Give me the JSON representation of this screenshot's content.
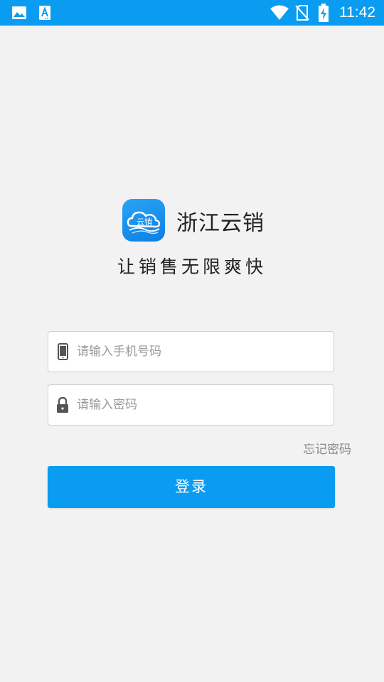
{
  "status_bar": {
    "time": "11:42",
    "background_color": "#0a9cf0",
    "left_icons": [
      "image-icon",
      "font-a-icon"
    ],
    "right_icons": [
      "wifi-icon",
      "no-sim-icon",
      "battery-charging-icon"
    ]
  },
  "app": {
    "icon_text": "云销",
    "name": "浙江云销",
    "slogan": "让销售无限爽快"
  },
  "form": {
    "phone": {
      "icon": "phone-icon",
      "placeholder": "请输入手机号码",
      "value": ""
    },
    "password": {
      "icon": "lock-icon",
      "placeholder": "请输入密码",
      "value": ""
    },
    "forgot_password_label": "忘记密码",
    "login_label": "登录"
  },
  "colors": {
    "accent": "#0a9cf0",
    "background": "#f2f2f2"
  }
}
